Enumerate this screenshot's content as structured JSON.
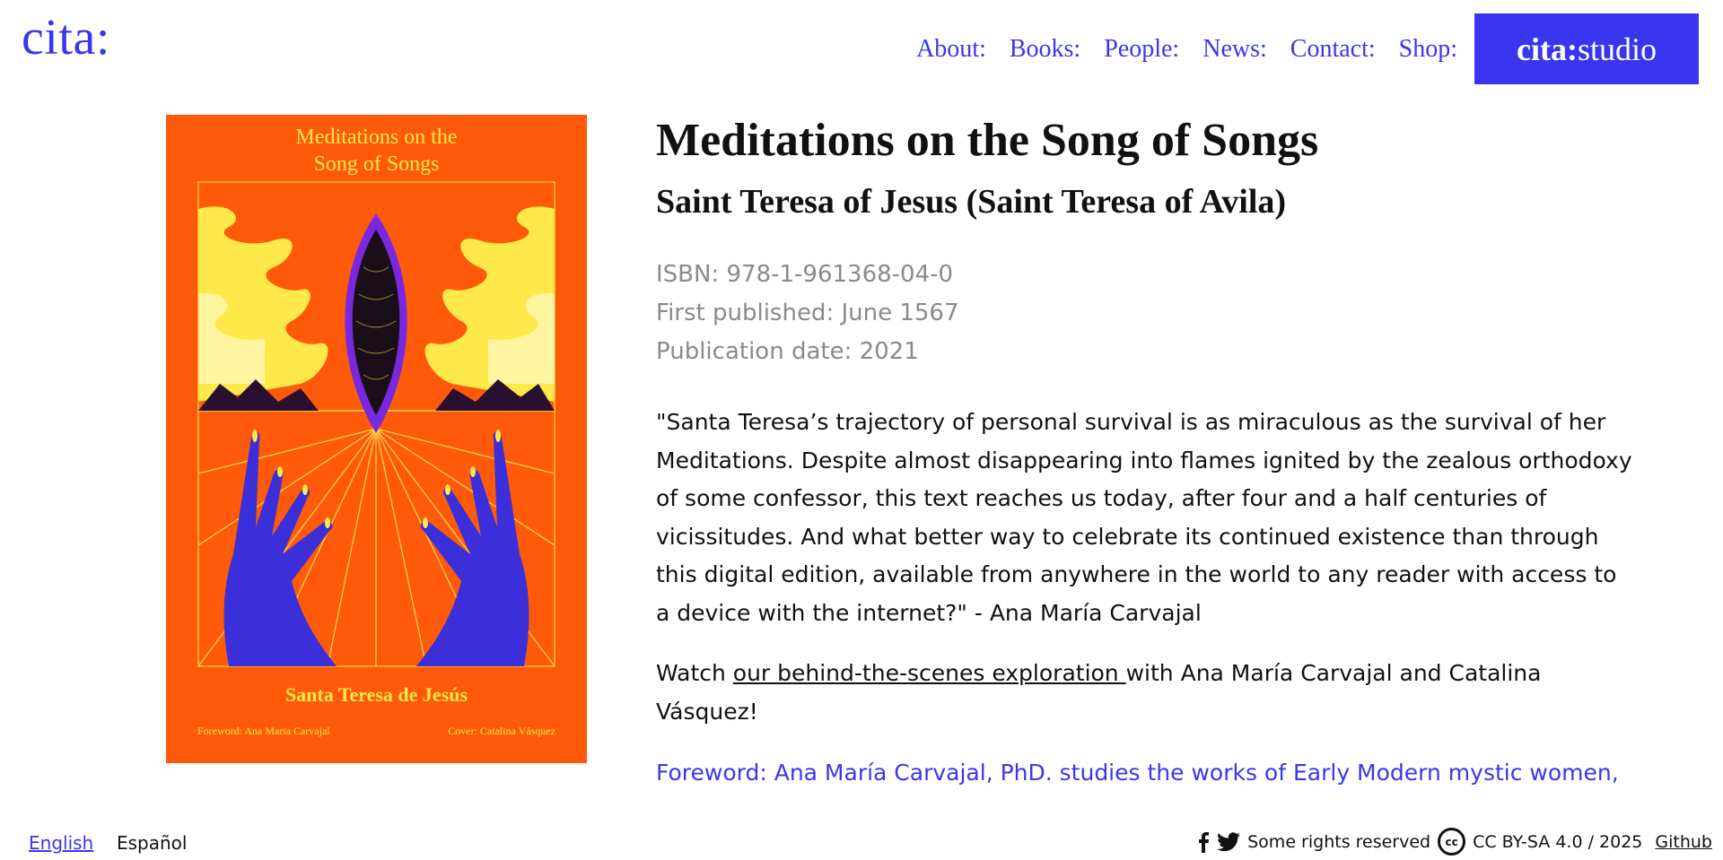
{
  "header": {
    "logo": "cita:",
    "nav": [
      "About:",
      "Books:",
      "People:",
      "News:",
      "Contact:",
      "Shop:"
    ],
    "studio_bold": "cita:",
    "studio_rest": "studio",
    "accent_color": "#3a36f0"
  },
  "cover": {
    "title_line1": "Meditations on the",
    "title_line2": "Song of Songs",
    "author": "Santa Teresa de Jesús",
    "foreword": "Foreword: Ana Maria Carvajal",
    "cover_credit": "Cover: Catalina Vásquez",
    "background_color": "#ff5a0a"
  },
  "book": {
    "title": "Meditations on the Song of Songs",
    "author": "Saint Teresa of Jesus (Saint Teresa of Avila)",
    "isbn": "ISBN: 978-1-961368-04-0",
    "first_published": "First published: June 1567",
    "publication_date": "Publication date: 2021",
    "quote": "\"Santa Teresa’s trajectory of personal survival is as miraculous as the survival of her Meditations. Despite almost disappearing into flames ignited by the zealous orthodoxy of some confessor, this text reaches us today, after four and a half centuries of vicissitudes. And what better way to celebrate its continued existence than through this digital edition, available from anywhere in the world to any reader with access to a device with the internet?\" - Ana María Carvajal",
    "watch_prefix": "Watch ",
    "watch_link": "our behind-the-scenes exploration ",
    "watch_suffix": "with Ana María Carvajal and Catalina Vásquez!",
    "foreword_text": "Foreword: Ana María Carvajal, PhD. studies the works of Early Modern mystic women,"
  },
  "footer": {
    "lang_english": "English",
    "lang_spanish": "Español",
    "rights": "Some rights reserved",
    "license": "CC BY-SA 4.0 / 2025",
    "github": "Github"
  }
}
